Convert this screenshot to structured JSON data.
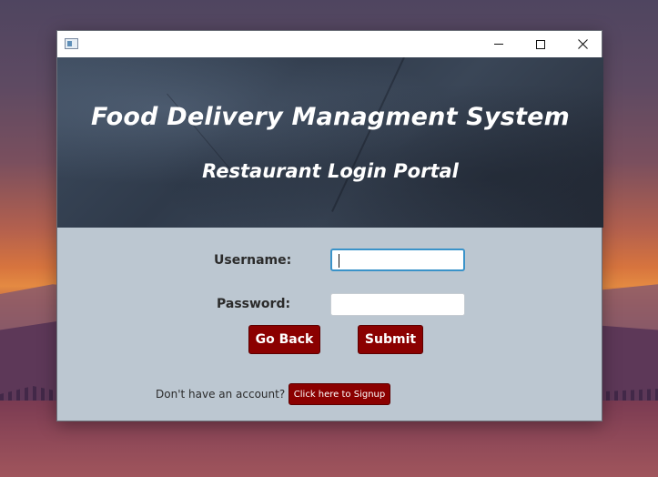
{
  "window": {
    "app_icon": "window-app-icon",
    "controls": {
      "minimize": "minimize-icon",
      "maximize": "maximize-icon",
      "close": "close-icon"
    }
  },
  "banner": {
    "title": "Food Delivery Managment System",
    "subtitle": "Restaurant Login Portal"
  },
  "form": {
    "username_label": "Username:",
    "username_value": "",
    "password_label": "Password:",
    "password_value": ""
  },
  "buttons": {
    "go_back": "Go Back",
    "submit": "Submit"
  },
  "signup": {
    "prompt": "Don't have an account?",
    "button": "Click here to Signup"
  },
  "colors": {
    "button_bg": "#8b0000",
    "form_bg": "#bcc7d1",
    "focus_border": "#3a93c9"
  }
}
